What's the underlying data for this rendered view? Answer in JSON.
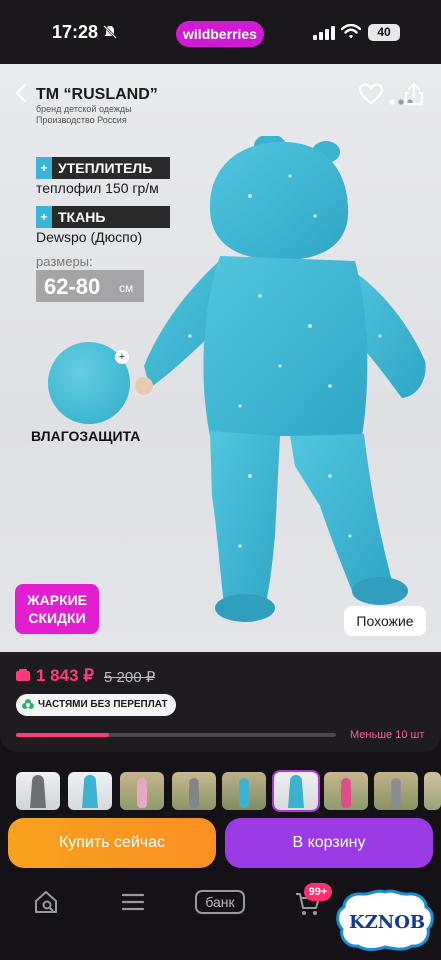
{
  "status_bar": {
    "time": "17:28",
    "app_pill": "wildberries",
    "battery": "40"
  },
  "product": {
    "brand": "ТМ “RUSLAND”",
    "brand_sub_1": "бренд детской одежды",
    "brand_sub_2": "Производство Россия",
    "feature_1_label": "УТЕПЛИТЕЛЬ",
    "feature_1_value": "теплофил 150 гр/м",
    "feature_2_label": "ТКАНЬ",
    "feature_2_value": "Dewspo (Дюспо)",
    "sizes_label": "размеры:",
    "sizes_value": "62-80",
    "sizes_unit": "см",
    "water_label": "ВЛАГОЗАЩИТА",
    "hot_badge_line1": "ЖАРКИЕ",
    "hot_badge_line2": "СКИДКИ",
    "similar_button": "Похожие"
  },
  "price": {
    "current": "1 843 ₽",
    "old": "5 200 ₽",
    "installments": "ЧАСТЯМИ БЕЗ ПЕРЕПЛАТ",
    "stock_text": "Меньше 10 шт",
    "stock_fraction": 0.29
  },
  "thumbnails": {
    "count": 9,
    "selected_index": 5
  },
  "actions": {
    "buy_now": "Купить сейчас",
    "to_cart": "В корзину"
  },
  "nav": {
    "bank_label": "банк",
    "cart_badge": "99+"
  },
  "watermark": {
    "text": "KZNOB"
  },
  "colors": {
    "accent_pink": "#ff3b7a",
    "accent_purple": "#9b3be6",
    "accent_orange": "#f7a21f",
    "brand_magenta": "#d21ad4",
    "suit_blue": "#3fb6d2"
  }
}
